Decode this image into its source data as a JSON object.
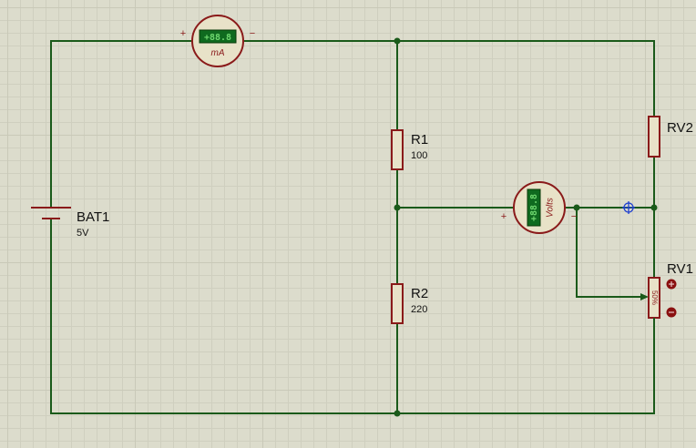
{
  "ammeter": {
    "display": "+88.8",
    "unit": "mA",
    "pos": "+",
    "neg": "−"
  },
  "voltmeter": {
    "display": "+88.8",
    "unit": "Volts",
    "pos": "+",
    "neg": "−"
  },
  "battery": {
    "ref": "BAT1",
    "value": "5V"
  },
  "r1": {
    "ref": "R1",
    "value": "100"
  },
  "r2": {
    "ref": "R2",
    "value": "220"
  },
  "rv1": {
    "ref": "RV1",
    "setting": "50%"
  },
  "rv2": {
    "ref": "RV2"
  },
  "colors": {
    "wire": "#1a5a1a",
    "component": "#8a1a1a",
    "lcd": "#0f6a1f",
    "background": "#dcdccc"
  }
}
